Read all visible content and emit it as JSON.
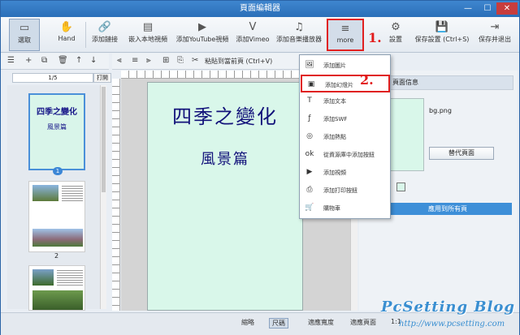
{
  "window": {
    "title": "頁面編輯器",
    "controls": {
      "minimize": "—",
      "maximize": "☐",
      "close": "✕"
    }
  },
  "toolbar": {
    "items": [
      {
        "id": "select",
        "label": "選取",
        "icon": "▭"
      },
      {
        "id": "hand",
        "label": "Hand",
        "icon": "✋"
      },
      {
        "id": "link",
        "label": "添加鏈接",
        "icon": "🔗"
      },
      {
        "id": "embed",
        "label": "嵌入本地視頻",
        "icon": "▤"
      },
      {
        "id": "youtube",
        "label": "添加YouTube視頻",
        "icon": "▶"
      },
      {
        "id": "vimeo",
        "label": "添加Vimeo",
        "icon": "V"
      },
      {
        "id": "audio",
        "label": "添加音樂播放器",
        "icon": "♫"
      },
      {
        "id": "more",
        "label": "more",
        "icon": "≡"
      },
      {
        "id": "settings",
        "label": "設置",
        "icon": "⚙"
      },
      {
        "id": "save",
        "label": "保存設置 (Ctrl+S)",
        "icon": "💾"
      },
      {
        "id": "save-exit",
        "label": "保存并退出",
        "icon": "⇥"
      }
    ]
  },
  "annotations": {
    "step1": "1.",
    "step2": "2."
  },
  "left_panel": {
    "tools": [
      "☰",
      "+",
      "⧉",
      "🗑",
      "↑",
      "↓"
    ],
    "pager": "1/5",
    "open_btn": "打開",
    "thumbs": [
      {
        "title": "四季之變化",
        "subtitle": "風景篇",
        "label": "1"
      },
      {
        "label": "2"
      },
      {
        "label": ""
      }
    ]
  },
  "canvas_toolbar": {
    "paste_label": "粘貼到當前頁 (Ctrl+V)"
  },
  "page": {
    "title": "四季之變化",
    "subtitle": "風景篇"
  },
  "more_menu": {
    "items": [
      {
        "label": "添加圖片",
        "icon": "🖼"
      },
      {
        "label": "添加幻燈片",
        "icon": "▣"
      },
      {
        "label": "添加文本",
        "icon": "T"
      },
      {
        "label": "添加SWF",
        "icon": "ƒ"
      },
      {
        "label": "添加熱點",
        "icon": "◎"
      },
      {
        "label": "從資源庫中添加按鈕",
        "icon": "ok"
      },
      {
        "label": "添加視頻",
        "icon": "▶"
      },
      {
        "label": "添加打印按鈕",
        "icon": "⎙"
      },
      {
        "label": "購物車",
        "icon": "🛒"
      }
    ]
  },
  "right_panel": {
    "header": "頁面信息",
    "bg_filename": "bg.png",
    "replace_button": "替代頁面",
    "apply_button": "應用到所有頁"
  },
  "statusbar": {
    "thumbnail": "縮略",
    "size_mode": "尺碼",
    "fit_width": "適應寬度",
    "fit_page": "適應頁面",
    "zoom": "1:1"
  },
  "watermark": {
    "brand": "PcSetting Blog",
    "url": "http://www.pcsetting.com"
  },
  "colors": {
    "accent": "#3d8fd8",
    "highlight": "#e02020",
    "page_bg": "#d9f7ea",
    "title_text": "#12127a"
  }
}
